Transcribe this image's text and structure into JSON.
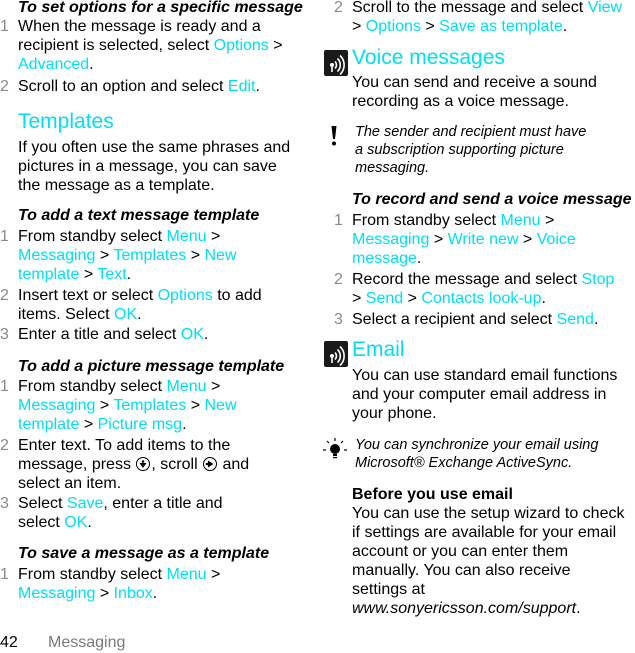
{
  "page": {
    "number": "42",
    "section": "Messaging",
    "accent_color": "#00dfee",
    "step_number_color": "#8a8a8a"
  },
  "left": {
    "set_options": {
      "heading": "To set options for a specific message",
      "steps": [
        {
          "n": "1",
          "parts": [
            "When the message is ready and a",
            "recipient is selected, select ",
            "Options",
            " >",
            "Advanced",
            "."
          ]
        },
        {
          "n": "2",
          "parts": [
            "Scroll to an option and select ",
            "Edit",
            "."
          ]
        }
      ]
    },
    "templates": {
      "title": "Templates",
      "body_lines": [
        "If you often use the same phrases and",
        "pictures in a message, you can save",
        "the message as a template."
      ]
    },
    "add_text": {
      "heading": "To add a text message template",
      "s1": {
        "n": "1",
        "a": "From standby select ",
        "menu": "Menu",
        "gt1": " >",
        "messaging": "Messaging",
        "gt2": " > ",
        "templates": "Templates",
        "gt3": " > ",
        "new": "New",
        "template": "template",
        "gt4": " > ",
        "text": "Text",
        "end": "."
      },
      "s2": {
        "n": "2",
        "a": "Insert text or select ",
        "options": "Options",
        "b": " to add",
        "c": "items. Select ",
        "ok": "OK",
        "end": "."
      },
      "s3": {
        "n": "3",
        "a": "Enter a title and select ",
        "ok": "OK",
        "end": "."
      }
    },
    "add_picture": {
      "heading": "To add a picture message template",
      "s1": {
        "n": "1",
        "a": "From standby select ",
        "menu": "Menu",
        "gt1": " >",
        "messaging": "Messaging",
        "gt2": " > ",
        "templates": "Templates",
        "gt3": " > ",
        "new": "New",
        "template": "template",
        "gt4": " > ",
        "picture": "Picture msg",
        "end": "."
      },
      "s2": {
        "n": "2",
        "l1": "Enter text. To add items to the",
        "l2a": "message, press ",
        "l2b": ", scroll ",
        "l2c": " and",
        "l3": "select an item.",
        "icon1": "navigation-key-select-icon",
        "icon2": "navigation-key-right-icon"
      },
      "s3": {
        "n": "3",
        "a": "Select ",
        "save": "Save",
        "b": ", enter a title and",
        "c": "select ",
        "ok": "OK",
        "end": "."
      }
    },
    "save_template": {
      "heading": "To save a message as a template",
      "s1": {
        "n": "1",
        "a": "From standby select ",
        "menu": "Menu",
        "gt1": " >",
        "messaging": "Messaging",
        "gt2": " > ",
        "inbox": "Inbox",
        "end": "."
      }
    }
  },
  "right": {
    "save_template_s2": {
      "n": "2",
      "a": "Scroll to the message and select ",
      "view": "View",
      "gt1": "> ",
      "options": "Options",
      "gt2": " > ",
      "save_as": "Save as template",
      "end": "."
    },
    "voice": {
      "title": "Voice messages",
      "icon": "operator-service-icon",
      "body_lines": [
        "You can send and receive a sound",
        "recording as a voice message."
      ],
      "note_icon": "warning-exclamation-icon",
      "note_lines": [
        "The sender and recipient must have",
        "a subscription supporting picture",
        "messaging."
      ],
      "heading": "To record and send a voice message",
      "s1": {
        "n": "1",
        "a": "From standby select ",
        "menu": "Menu",
        "gt1": " >",
        "messaging": "Messaging",
        "gt2": " > ",
        "write_new": "Write new",
        "gt3": " > ",
        "voice": "Voice",
        "message": "message",
        "end": "."
      },
      "s2": {
        "n": "2",
        "a": "Record the message and select ",
        "stop": "Stop",
        "gt1": "> ",
        "send": "Send",
        "gt2": " > ",
        "contacts": "Contacts look-up",
        "end": "."
      },
      "s3": {
        "n": "3",
        "a": "Select a recipient and select ",
        "send": "Send",
        "end": "."
      }
    },
    "email": {
      "title": "Email",
      "icon": "operator-service-icon",
      "body_lines": [
        "You can use standard email functions",
        "and your computer email address in",
        "your phone."
      ],
      "tip_icon": "tip-lightbulb-icon",
      "tip_lines": [
        "You can synchronize your email using",
        "Microsoft® Exchange ActiveSync."
      ],
      "before_heading": "Before you use email",
      "before_lines": [
        "You can use the setup wizard to check",
        "if settings are available for your email",
        "account or you can enter them",
        "manually. You can also receive",
        "settings at"
      ],
      "url": "www.sonyericsson.com/support",
      "url_end": "."
    }
  }
}
